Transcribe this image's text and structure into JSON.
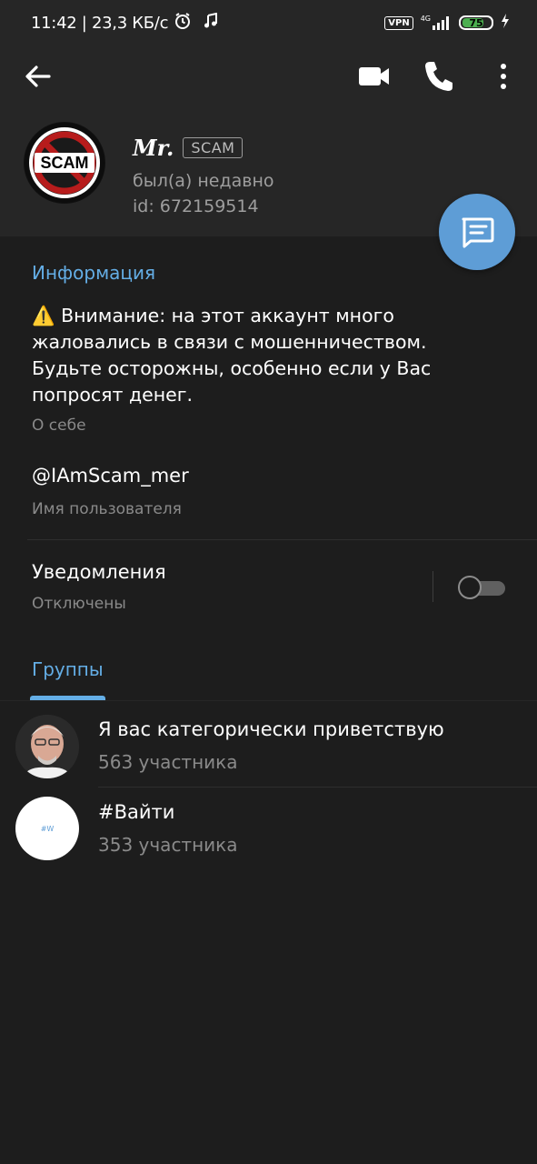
{
  "status_bar": {
    "time_speed": "11:42 | 23,3 КБ/с",
    "vpn": "VPN",
    "network": "4G",
    "battery": "75",
    "battery_fraction": 0.75
  },
  "header": {
    "icons": [
      "arrow-left-icon",
      "video-camera-icon",
      "phone-icon",
      "more-vertical-icon"
    ]
  },
  "profile": {
    "name": "Mr.",
    "badge": "SCAM",
    "status": "был(а) недавно",
    "id": "id: 672159514",
    "avatar_text": "SCAM"
  },
  "info": {
    "section_title": "Информация",
    "bio_warning_icon": "⚠️",
    "bio": "Внимание: на этот аккаунт много жаловались в связи с мошенничеством. Будьте осторожны, особенно если у Вас попросят денег.",
    "bio_label": "О себе",
    "username": "@IAmScam_mer",
    "username_label": "Имя пользователя",
    "notifications_title": "Уведомления",
    "notifications_status": "Отключены",
    "notifications_enabled": false
  },
  "groups": {
    "section_title": "Группы",
    "items": [
      {
        "name": "Я вас категорически приветствую",
        "members": "563 участника",
        "avatar": "photo"
      },
      {
        "name": "#Вайти",
        "members": "353 участника",
        "avatar": "#W"
      }
    ]
  },
  "colors": {
    "accent": "#64aee6",
    "fab": "#5e9dd6",
    "background": "#1d1d1d",
    "header_bg": "#262626"
  }
}
